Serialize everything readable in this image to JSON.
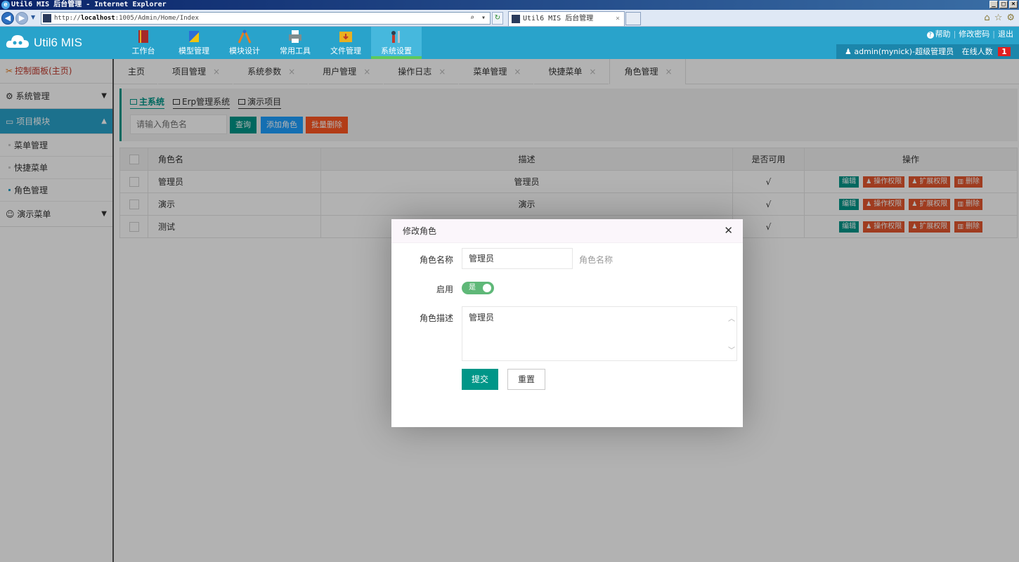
{
  "browser": {
    "title": "Util6 MIS 后台管理 - Internet Explorer",
    "address_prefix": "http://",
    "address_host": "localhost",
    "address_path": ":1005/Admin/Home/Index",
    "tab_title": "Util6 MIS 后台管理"
  },
  "app": {
    "logo_text": "Util6 MIS",
    "topnav": [
      {
        "label": "工作台",
        "icon": "book-icon",
        "color": "#c0392b"
      },
      {
        "label": "模型管理",
        "icon": "ruler-icon",
        "color": "#2c6ed5"
      },
      {
        "label": "模块设计",
        "icon": "compass-icon",
        "color": "#e67e22"
      },
      {
        "label": "常用工具",
        "icon": "printer-icon",
        "color": "#95a5a6"
      },
      {
        "label": "文件管理",
        "icon": "folder-icon",
        "color": "#e8b020"
      },
      {
        "label": "系统设置",
        "icon": "tools-icon",
        "color": "#c0392b",
        "active": true
      }
    ],
    "header_links": {
      "help": "帮助",
      "change_password": "修改密码",
      "logout": "退出"
    },
    "user_label": "admin(mynick)-超级管理员",
    "online_label": "在线人数",
    "online_count": "1",
    "accent_color": "#29a3cb"
  },
  "sidebar": {
    "home": "控制面板(主页)",
    "groups": [
      {
        "label": "系统管理"
      },
      {
        "label": "项目模块",
        "items": [
          "菜单管理",
          "快捷菜单",
          "角色管理"
        ]
      },
      {
        "label": "演示菜单"
      }
    ]
  },
  "tabs": [
    "主页",
    "项目管理",
    "系统参数",
    "用户管理",
    "操作日志",
    "菜单管理",
    "快捷菜单",
    "角色管理"
  ],
  "search": {
    "systems": [
      "主系统",
      "Erp管理系统",
      "演示项目"
    ],
    "placeholder": "请输入角色名",
    "query": "查询",
    "add": "添加角色",
    "batch_delete": "批量删除"
  },
  "table": {
    "headers": [
      "角色名",
      "描述",
      "是否可用",
      "操作"
    ],
    "rows": [
      {
        "name": "管理员",
        "desc": "管理员",
        "enabled": "√"
      },
      {
        "name": "演示",
        "desc": "演示",
        "enabled": "√"
      },
      {
        "name": "测试",
        "desc": "",
        "enabled": "√"
      }
    ],
    "actions": {
      "edit": "编辑",
      "perm": "操作权限",
      "ext": "扩展权限",
      "del": "删除"
    }
  },
  "dialog": {
    "title": "修改角色",
    "name_label": "角色名称",
    "name_value": "管理员",
    "name_tip": "角色名称",
    "enable_label": "启用",
    "enable_value": "是",
    "desc_label": "角色描述",
    "desc_value": "管理员",
    "submit": "提交",
    "reset": "重置"
  }
}
